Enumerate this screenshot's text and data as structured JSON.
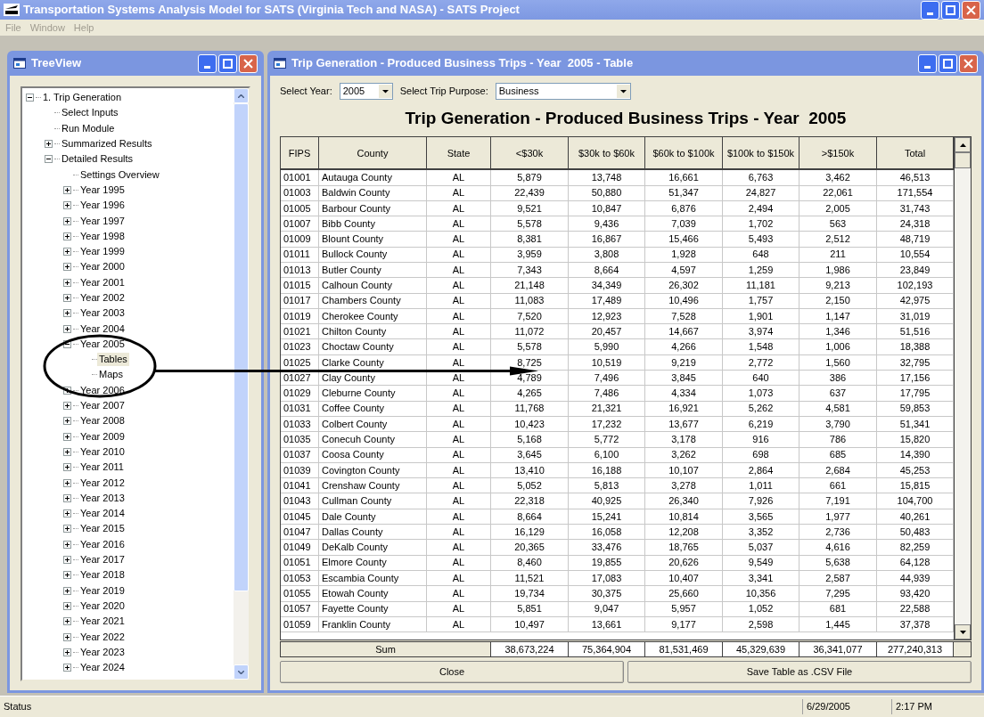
{
  "window": {
    "title": "Transportation Systems Analysis Model for SATS (Virginia Tech and NASA) - SATS Project"
  },
  "menu": [
    "File",
    "Window",
    "Help"
  ],
  "tree_window": {
    "title": "TreeView",
    "tree": [
      {
        "label": "1. Trip Generation",
        "expanded": true,
        "selected": false,
        "children": [
          {
            "label": "Select Inputs",
            "selected": false
          },
          {
            "label": "Run Module",
            "selected": false
          },
          {
            "label": "Summarized Results",
            "expanded": false,
            "selected": false
          },
          {
            "label": "Detailed Results",
            "expanded": true,
            "selected": false,
            "children": [
              {
                "label": "Settings Overview",
                "selected": false
              },
              {
                "label": "Year 1995",
                "expanded": false,
                "selected": false
              },
              {
                "label": "Year 1996",
                "expanded": false,
                "selected": false
              },
              {
                "label": "Year 1997",
                "expanded": false,
                "selected": false
              },
              {
                "label": "Year 1998",
                "expanded": false,
                "selected": false
              },
              {
                "label": "Year 1999",
                "expanded": false,
                "selected": false
              },
              {
                "label": "Year 2000",
                "expanded": false,
                "selected": false
              },
              {
                "label": "Year 2001",
                "expanded": false,
                "selected": false
              },
              {
                "label": "Year 2002",
                "expanded": false,
                "selected": false
              },
              {
                "label": "Year 2003",
                "expanded": false,
                "selected": false
              },
              {
                "label": "Year 2004",
                "expanded": false,
                "selected": false
              },
              {
                "label": "Year 2005",
                "expanded": true,
                "selected": false,
                "children": [
                  {
                    "label": "Tables",
                    "selected": true
                  },
                  {
                    "label": "Maps",
                    "selected": false
                  }
                ]
              },
              {
                "label": "Year 2006",
                "expanded": false,
                "selected": false
              },
              {
                "label": "Year 2007",
                "expanded": false,
                "selected": false
              },
              {
                "label": "Year 2008",
                "expanded": false,
                "selected": false
              },
              {
                "label": "Year 2009",
                "expanded": false,
                "selected": false
              },
              {
                "label": "Year 2010",
                "expanded": false,
                "selected": false
              },
              {
                "label": "Year 2011",
                "expanded": false,
                "selected": false
              },
              {
                "label": "Year 2012",
                "expanded": false,
                "selected": false
              },
              {
                "label": "Year 2013",
                "expanded": false,
                "selected": false
              },
              {
                "label": "Year 2014",
                "expanded": false,
                "selected": false
              },
              {
                "label": "Year 2015",
                "expanded": false,
                "selected": false
              },
              {
                "label": "Year 2016",
                "expanded": false,
                "selected": false
              },
              {
                "label": "Year 2017",
                "expanded": false,
                "selected": false
              },
              {
                "label": "Year 2018",
                "expanded": false,
                "selected": false
              },
              {
                "label": "Year 2019",
                "expanded": false,
                "selected": false
              },
              {
                "label": "Year 2020",
                "expanded": false,
                "selected": false
              },
              {
                "label": "Year 2021",
                "expanded": false,
                "selected": false
              },
              {
                "label": "Year 2022",
                "expanded": false,
                "selected": false
              },
              {
                "label": "Year 2023",
                "expanded": false,
                "selected": false
              },
              {
                "label": "Year 2024",
                "expanded": false,
                "selected": false
              }
            ]
          }
        ]
      }
    ]
  },
  "table_window": {
    "title": "Trip Generation - Produced Business Trips - Year  2005 - Table",
    "year_label": "Select Year:",
    "year": "2005",
    "purpose_label": "Select Trip Purpose:",
    "purpose": "Business",
    "heading": "Trip Generation - Produced Business Trips - Year  2005",
    "columns": [
      "FIPS",
      "County",
      "State",
      "<$30k",
      "$30k to $60k",
      "$60k to $100k",
      "$100k to $150k",
      ">$150k",
      "Total"
    ],
    "rows": [
      [
        "01001",
        "Autauga County",
        "AL",
        "5,879",
        "13,748",
        "16,661",
        "6,763",
        "3,462",
        "46,513"
      ],
      [
        "01003",
        "Baldwin County",
        "AL",
        "22,439",
        "50,880",
        "51,347",
        "24,827",
        "22,061",
        "171,554"
      ],
      [
        "01005",
        "Barbour County",
        "AL",
        "9,521",
        "10,847",
        "6,876",
        "2,494",
        "2,005",
        "31,743"
      ],
      [
        "01007",
        "Bibb County",
        "AL",
        "5,578",
        "9,436",
        "7,039",
        "1,702",
        "563",
        "24,318"
      ],
      [
        "01009",
        "Blount County",
        "AL",
        "8,381",
        "16,867",
        "15,466",
        "5,493",
        "2,512",
        "48,719"
      ],
      [
        "01011",
        "Bullock County",
        "AL",
        "3,959",
        "3,808",
        "1,928",
        "648",
        "211",
        "10,554"
      ],
      [
        "01013",
        "Butler County",
        "AL",
        "7,343",
        "8,664",
        "4,597",
        "1,259",
        "1,986",
        "23,849"
      ],
      [
        "01015",
        "Calhoun County",
        "AL",
        "21,148",
        "34,349",
        "26,302",
        "11,181",
        "9,213",
        "102,193"
      ],
      [
        "01017",
        "Chambers County",
        "AL",
        "11,083",
        "17,489",
        "10,496",
        "1,757",
        "2,150",
        "42,975"
      ],
      [
        "01019",
        "Cherokee County",
        "AL",
        "7,520",
        "12,923",
        "7,528",
        "1,901",
        "1,147",
        "31,019"
      ],
      [
        "01021",
        "Chilton County",
        "AL",
        "11,072",
        "20,457",
        "14,667",
        "3,974",
        "1,346",
        "51,516"
      ],
      [
        "01023",
        "Choctaw County",
        "AL",
        "5,578",
        "5,990",
        "4,266",
        "1,548",
        "1,006",
        "18,388"
      ],
      [
        "01025",
        "Clarke County",
        "AL",
        "8,725",
        "10,519",
        "9,219",
        "2,772",
        "1,560",
        "32,795"
      ],
      [
        "01027",
        "Clay County",
        "AL",
        "4,789",
        "7,496",
        "3,845",
        "640",
        "386",
        "17,156"
      ],
      [
        "01029",
        "Cleburne County",
        "AL",
        "4,265",
        "7,486",
        "4,334",
        "1,073",
        "637",
        "17,795"
      ],
      [
        "01031",
        "Coffee County",
        "AL",
        "11,768",
        "21,321",
        "16,921",
        "5,262",
        "4,581",
        "59,853"
      ],
      [
        "01033",
        "Colbert County",
        "AL",
        "10,423",
        "17,232",
        "13,677",
        "6,219",
        "3,790",
        "51,341"
      ],
      [
        "01035",
        "Conecuh County",
        "AL",
        "5,168",
        "5,772",
        "3,178",
        "916",
        "786",
        "15,820"
      ],
      [
        "01037",
        "Coosa County",
        "AL",
        "3,645",
        "6,100",
        "3,262",
        "698",
        "685",
        "14,390"
      ],
      [
        "01039",
        "Covington County",
        "AL",
        "13,410",
        "16,188",
        "10,107",
        "2,864",
        "2,684",
        "45,253"
      ],
      [
        "01041",
        "Crenshaw County",
        "AL",
        "5,052",
        "5,813",
        "3,278",
        "1,011",
        "661",
        "15,815"
      ],
      [
        "01043",
        "Cullman County",
        "AL",
        "22,318",
        "40,925",
        "26,340",
        "7,926",
        "7,191",
        "104,700"
      ],
      [
        "01045",
        "Dale County",
        "AL",
        "8,664",
        "15,241",
        "10,814",
        "3,565",
        "1,977",
        "40,261"
      ],
      [
        "01047",
        "Dallas County",
        "AL",
        "16,129",
        "16,058",
        "12,208",
        "3,352",
        "2,736",
        "50,483"
      ],
      [
        "01049",
        "DeKalb County",
        "AL",
        "20,365",
        "33,476",
        "18,765",
        "5,037",
        "4,616",
        "82,259"
      ],
      [
        "01051",
        "Elmore County",
        "AL",
        "8,460",
        "19,855",
        "20,626",
        "9,549",
        "5,638",
        "64,128"
      ],
      [
        "01053",
        "Escambia County",
        "AL",
        "11,521",
        "17,083",
        "10,407",
        "3,341",
        "2,587",
        "44,939"
      ],
      [
        "01055",
        "Etowah County",
        "AL",
        "19,734",
        "30,375",
        "25,660",
        "10,356",
        "7,295",
        "93,420"
      ],
      [
        "01057",
        "Fayette County",
        "AL",
        "5,851",
        "9,047",
        "5,957",
        "1,052",
        "681",
        "22,588"
      ],
      [
        "01059",
        "Franklin County",
        "AL",
        "10,497",
        "13,661",
        "9,177",
        "2,598",
        "1,445",
        "37,378"
      ]
    ],
    "sum": {
      "label": "Sum",
      "values": [
        "38,673,224",
        "75,364,904",
        "81,531,469",
        "45,329,639",
        "36,341,077",
        "277,240,313"
      ]
    },
    "buttons": [
      "Close",
      "Save Table as .CSV File"
    ]
  },
  "status_bar": {
    "text": "Status",
    "date": "6/29/2005",
    "time": "2:17 PM"
  }
}
